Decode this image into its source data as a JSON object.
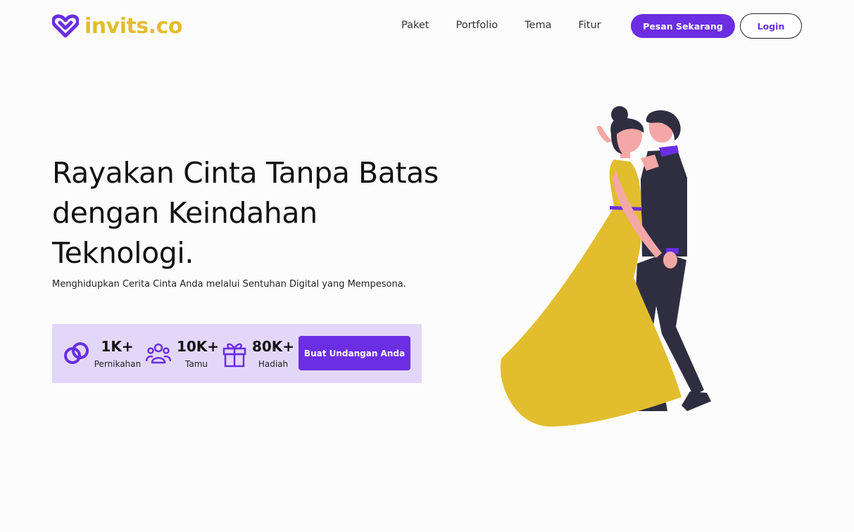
{
  "brand": {
    "name": "invits.co",
    "logo_color": "#e2bd2e",
    "icon_color": "#6b2ee3"
  },
  "nav": {
    "items": [
      {
        "label": "Paket"
      },
      {
        "label": "Portfolio"
      },
      {
        "label": "Tema"
      },
      {
        "label": "Fitur"
      }
    ],
    "order_button": "Pesan Sekarang",
    "login_button": "Login"
  },
  "hero": {
    "title": "Rayakan Cinta Tanpa Batas dengan Keindahan Teknologi.",
    "subtitle": "Menghidupkan Cerita Cinta Anda melalui Sentuhan Digital yang Mempesona."
  },
  "stats": [
    {
      "icon": "rings-icon",
      "value": "1K+",
      "label": "Pernikahan"
    },
    {
      "icon": "people-icon",
      "value": "10K+",
      "label": "Tamu"
    },
    {
      "icon": "gift-icon",
      "value": "80K+",
      "label": "Hadiah"
    }
  ],
  "cta_button": "Buat Undangan Anda",
  "colors": {
    "accent": "#6b2ee3",
    "stats_bg": "#e3d7f9",
    "dress": "#e2bd2e",
    "suit": "#2f2e41"
  }
}
